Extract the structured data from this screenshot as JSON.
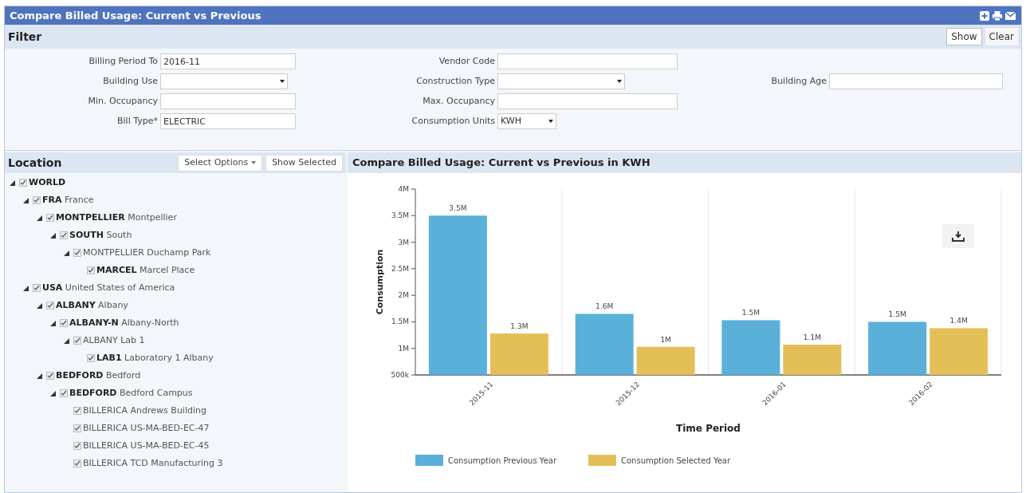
{
  "window": {
    "title": "Compare Billed Usage: Current vs Previous"
  },
  "filter": {
    "title": "Filter",
    "buttons": [
      "Show",
      "Clear"
    ],
    "rows": [
      [
        {
          "label": "Billing Period To",
          "value": "2016-11",
          "kind": "text"
        },
        {
          "label": "Vendor Code",
          "kind": "text"
        }
      ],
      [
        {
          "label": "Building Use",
          "kind": "select"
        },
        {
          "label": "Construction Type",
          "kind": "select"
        },
        {
          "label": "Building Age",
          "kind": "text"
        }
      ],
      [
        {
          "label": "Min. Occupancy",
          "kind": "text"
        },
        {
          "label": "Max. Occupancy",
          "kind": "text"
        }
      ],
      [
        {
          "label": "Bill Type*",
          "value": "ELECTRIC",
          "kind": "text"
        },
        {
          "label": "Consumption Units",
          "value": "KWH",
          "kind": "select"
        }
      ]
    ]
  },
  "location": {
    "title": "Location",
    "buttons": [
      "Select Options",
      "Show Selected"
    ],
    "tree": [
      {
        "label": "**WORLD**",
        "checked": true,
        "expanded": true,
        "children": [
          {
            "label": "**FRA** France",
            "checked": true,
            "expanded": true,
            "children": [
              {
                "label": "**MONTPELLIER** Montpellier",
                "checked": true,
                "expanded": true,
                "children": [
                  {
                    "label": "**SOUTH** South",
                    "checked": true,
                    "expanded": true,
                    "children": [
                      {
                        "label": "MONTPELLIER Duchamp Park",
                        "checked": true,
                        "expanded": true,
                        "children": [
                          {
                            "label": "**MARCEL** Marcel Place",
                            "checked": true
                          }
                        ]
                      }
                    ]
                  }
                ]
              }
            ]
          },
          {
            "label": "**USA** United States of America",
            "checked": true,
            "expanded": true,
            "children": [
              {
                "label": "**ALBANY** Albany",
                "checked": true,
                "expanded": true,
                "children": [
                  {
                    "label": "**ALBANY-N** Albany-North",
                    "checked": true,
                    "expanded": true,
                    "children": [
                      {
                        "label": "ALBANY Lab 1",
                        "checked": true,
                        "expanded": true,
                        "children": [
                          {
                            "label": "**LAB1** Laboratory 1 Albany",
                            "checked": true
                          }
                        ]
                      }
                    ]
                  }
                ]
              },
              {
                "label": "**BEDFORD** Bedford",
                "checked": true,
                "expanded": true,
                "children": [
                  {
                    "label": "**BEDFORD** Bedford Campus",
                    "checked": true,
                    "expanded": true,
                    "children": [
                      {
                        "label": "BILLERICA Andrews Building",
                        "checked": true
                      },
                      {
                        "label": "BILLERICA US-MA-BED-EC-47",
                        "checked": true
                      },
                      {
                        "label": "BILLERICA US-MA-BED-EC-45",
                        "checked": true
                      },
                      {
                        "label": "BILLERICA TCD Manufacturing 3",
                        "checked": true
                      }
                    ]
                  }
                ]
              }
            ]
          }
        ]
      }
    ]
  },
  "chart_panel": {
    "title": "Compare Billed Usage: Current vs Previous in KWH",
    "chart_data": {
      "type": "bar",
      "xlabel": "Time Period",
      "ylabel": "Consumption",
      "categories": [
        "2015-11",
        "2015-12",
        "2016-01",
        "2016-02"
      ],
      "series": [
        {
          "name": "Consumption Previous Year",
          "color": "#5ab0d9",
          "values": [
            3500000,
            1650000,
            1530000,
            1500000
          ]
        },
        {
          "name": "Consumption Selected Year",
          "color": "#e4bf58",
          "values": [
            1280000,
            1030000,
            1070000,
            1380000
          ]
        }
      ],
      "legend": true,
      "ylim": [
        500000,
        4000000
      ],
      "yticks": [
        {
          "value": 500000,
          "label": "500k"
        },
        {
          "value": 1000000,
          "label": "1M"
        },
        {
          "value": 1500000,
          "label": "1.5M"
        },
        {
          "value": 2000000,
          "label": "2M"
        },
        {
          "value": 2500000,
          "label": "2.5M"
        },
        {
          "value": 3000000,
          "label": "3M"
        },
        {
          "value": 3500000,
          "label": "3.5M"
        },
        {
          "value": 4000000,
          "label": "4M"
        }
      ],
      "value_labels": [
        [
          "3.5M",
          "1.6M",
          "1.5M",
          "1.5M"
        ],
        [
          "1.3M",
          "1M",
          "1.1M",
          "1.4M"
        ]
      ]
    }
  }
}
